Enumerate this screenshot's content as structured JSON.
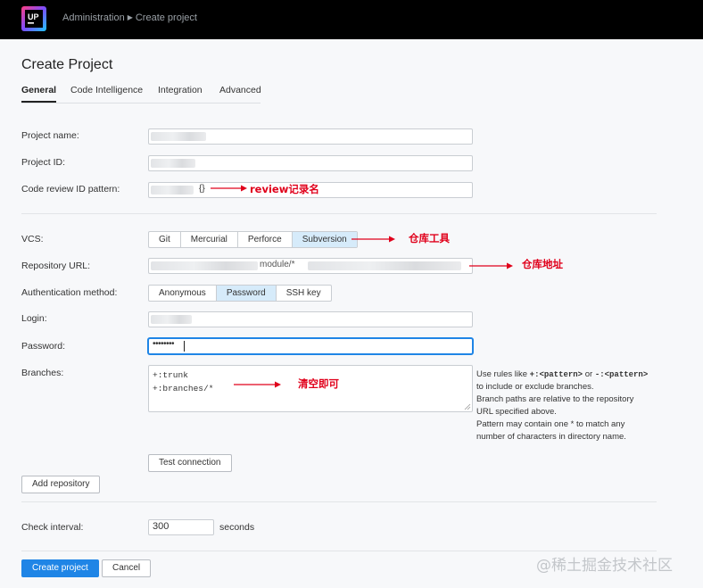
{
  "header": {
    "breadcrumb_parent": "Administration",
    "breadcrumb_current": "Create project",
    "logo_text": "UP"
  },
  "page": {
    "title": "Create Project",
    "tabs": [
      "General",
      "Code Intelligence",
      "Integration",
      "Advanced"
    ],
    "active_tab": "General"
  },
  "form": {
    "project_name_label": "Project name:",
    "project_id_label": "Project ID:",
    "code_review_label": "Code review ID pattern:",
    "code_review_value_suffix": "{}",
    "vcs_label": "VCS:",
    "vcs_options": [
      "Git",
      "Mercurial",
      "Perforce",
      "Subversion"
    ],
    "vcs_selected": "Subversion",
    "repo_url_label": "Repository URL:",
    "repo_url_visible_fragment": "module/*",
    "auth_label": "Authentication method:",
    "auth_options": [
      "Anonymous",
      "Password",
      "SSH key"
    ],
    "auth_selected": "Password",
    "login_label": "Login:",
    "password_label": "Password:",
    "password_value": "••••••••",
    "branches_label": "Branches:",
    "branches_lines": [
      "+:trunk",
      "+:branches/*"
    ],
    "branches_hint": {
      "line1_pre": "Use rules like ",
      "code1": "+:<pattern>",
      "line1_mid": " or ",
      "code2": "-:<pattern>",
      "line2": "to include or exclude branches.",
      "line3": "Branch paths are relative to the repository",
      "line4": "URL specified above.",
      "line5": "Pattern may contain one * to match any",
      "line6": "number of characters in directory name."
    },
    "test_connection_button": "Test connection",
    "add_repository_button": "Add repository",
    "check_interval_label": "Check interval:",
    "check_interval_value": "300",
    "check_interval_unit": "seconds"
  },
  "footer": {
    "create_button": "Create project",
    "cancel_button": "Cancel"
  },
  "annotations": {
    "code_review": "review记录名",
    "vcs": "仓库工具",
    "repo_url": "仓库地址",
    "branches": "清空即可",
    "color": "#e0001b"
  },
  "watermark": "@稀土掘金技术社区",
  "colors": {
    "primary": "#1f85e6",
    "selected_segment": "#d6ebfa",
    "focus_border": "#1f85e6",
    "topbar": "#000000"
  }
}
